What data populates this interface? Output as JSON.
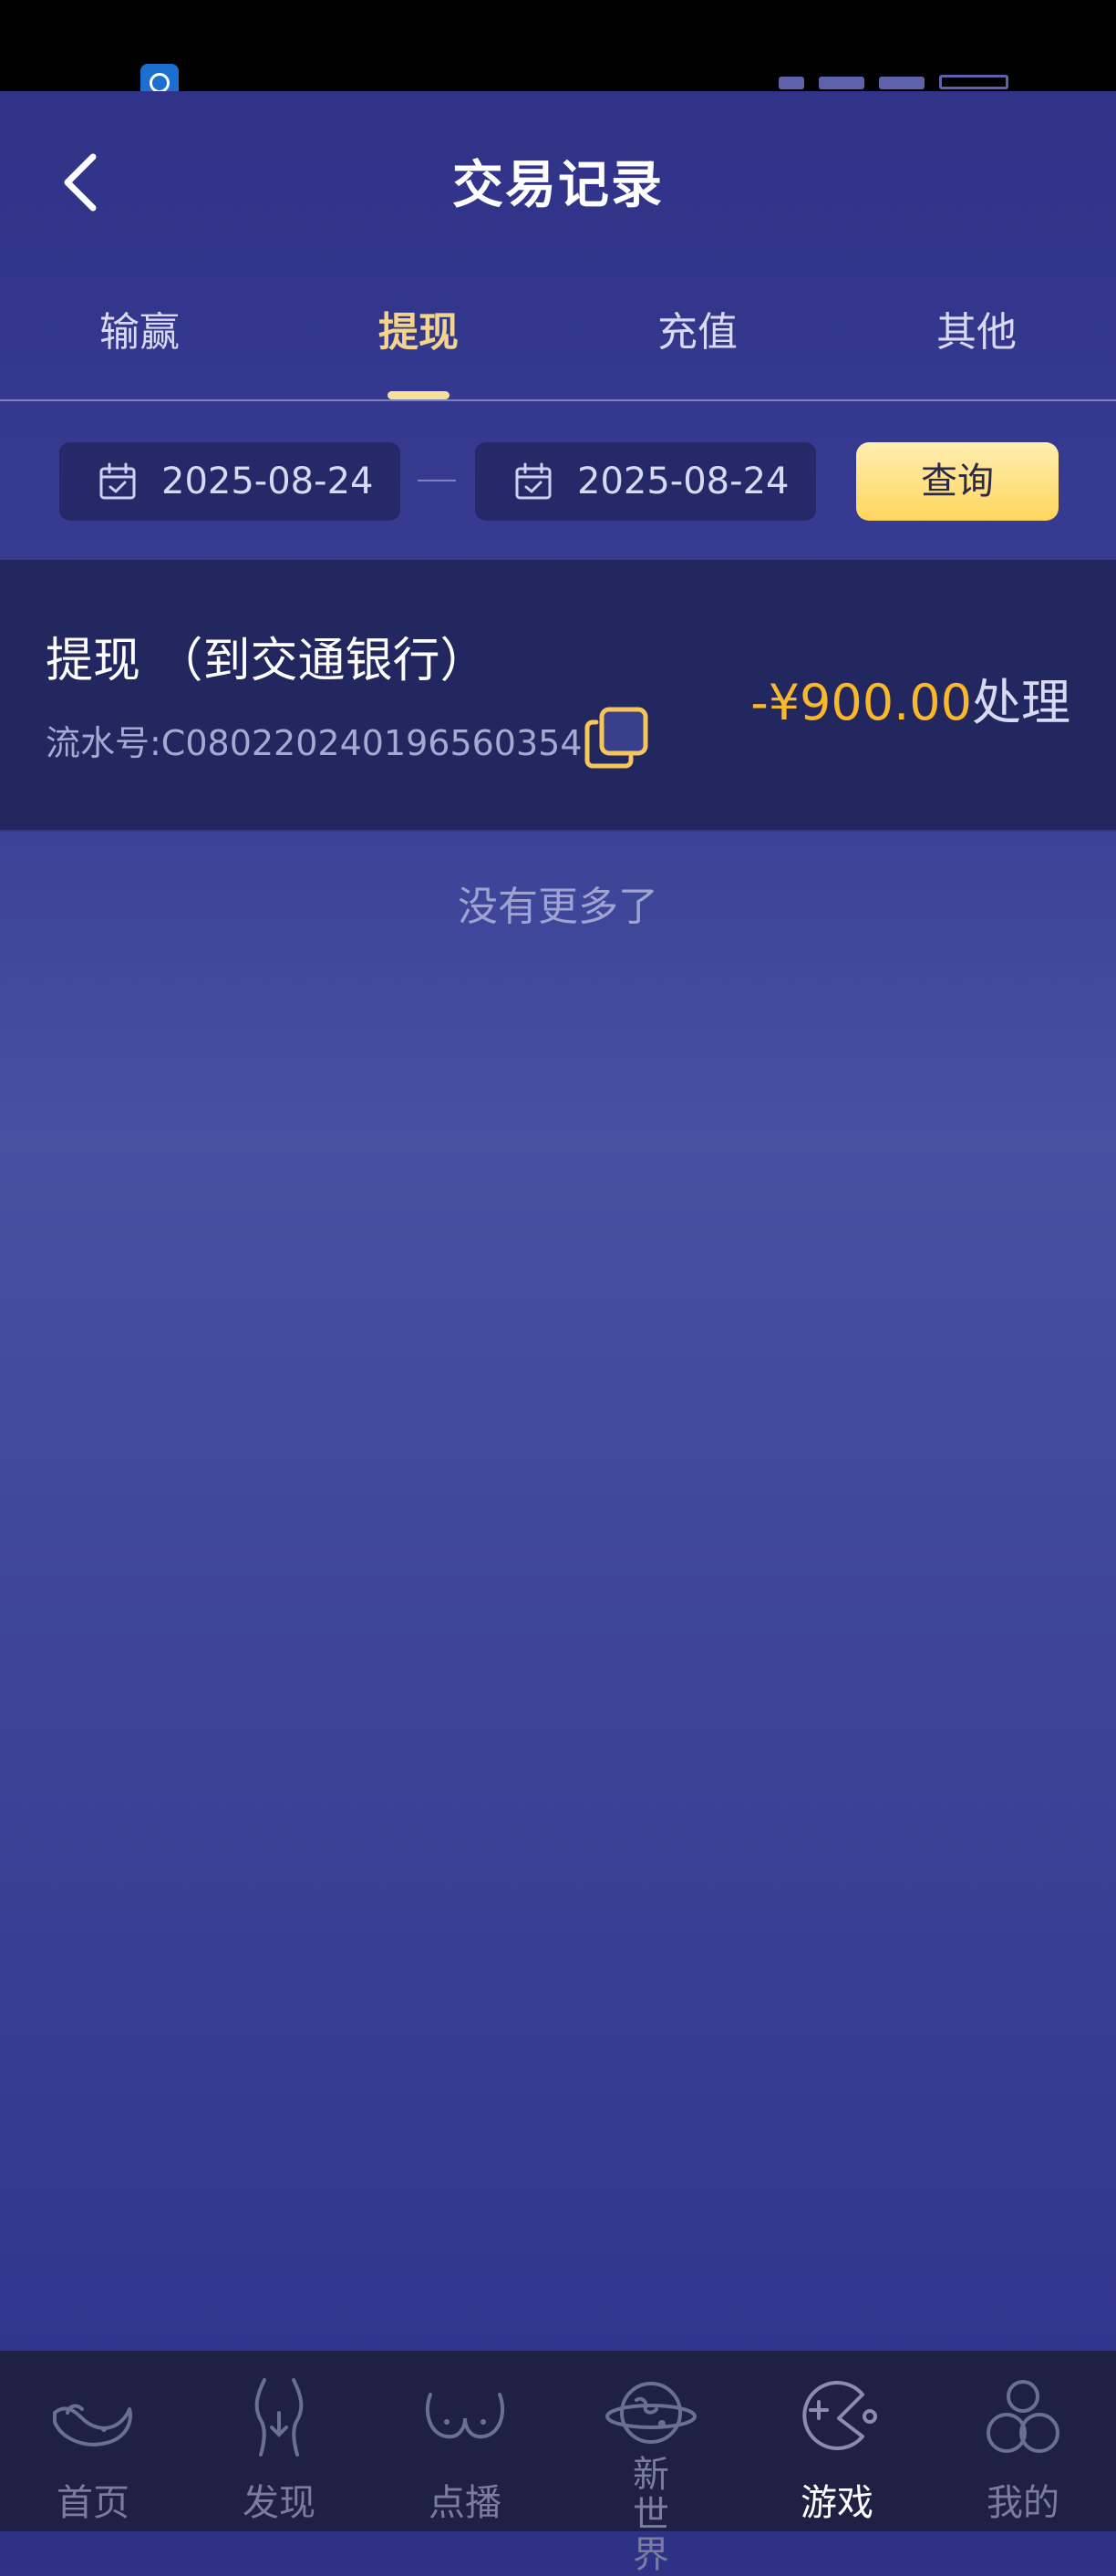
{
  "header": {
    "title": "交易记录"
  },
  "tabs": [
    {
      "label": "输赢"
    },
    {
      "label": "提现"
    },
    {
      "label": "充值"
    },
    {
      "label": "其他"
    }
  ],
  "filter": {
    "start_date": "2025-08-24",
    "end_date": "2025-08-24",
    "query_label": "查询"
  },
  "records": [
    {
      "title": "提现 （到交通银行）",
      "serial": "流水号:C080220240196560354",
      "amount": "-¥900.00",
      "status": "处理"
    }
  ],
  "no_more_text": "没有更多了",
  "bottom_nav": [
    {
      "label": "首页"
    },
    {
      "label": "发现"
    },
    {
      "label": "点播"
    },
    {
      "label": "新世界"
    },
    {
      "label": "游戏"
    },
    {
      "label": "我的"
    }
  ],
  "colors": {
    "accent_gold": "#f9b82a",
    "tab_active": "#f3d48a",
    "query_button": "#ffd65e"
  }
}
